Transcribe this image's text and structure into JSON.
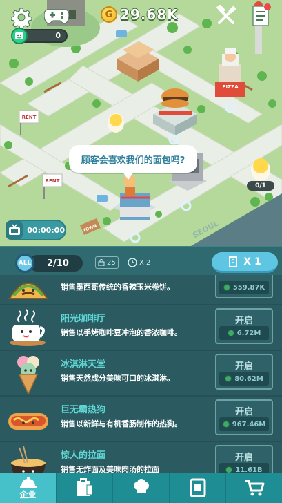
{
  "hud": {
    "coins": "29.68K",
    "coin_symbol": "G",
    "xp_value": "0",
    "speech": "顾客会喜欢我们的面包吗?",
    "timer": "00:00:00",
    "chick_counter": "0/1"
  },
  "map_signs": {
    "rent": "RENT",
    "pizza": "PIZZA",
    "town": "TOWN",
    "seoul": "SEOUL"
  },
  "panel": {
    "all_label": "ALL",
    "count": "2/10",
    "lock_value": "25",
    "speed_value": "X 2",
    "multiplier": "X 1"
  },
  "businesses": [
    {
      "title": "",
      "desc": "销售墨西哥传统的香辣玉米卷饼。",
      "button": "",
      "cost": "559.87K",
      "icon": "taco-icon"
    },
    {
      "title": "阳光咖啡厅",
      "desc": "销售以手烤咖啡豆冲泡的香浓咖啡。",
      "button": "开启",
      "cost": "6.72M",
      "icon": "coffee-cup-icon"
    },
    {
      "title": "冰淇淋天堂",
      "desc": "销售天然成分美味可口的冰淇淋。",
      "button": "开启",
      "cost": "80.62M",
      "icon": "ice-cream-icon"
    },
    {
      "title": "巨无霸热狗",
      "desc": "销售以新鲜与有机香肠制作的热狗。",
      "button": "开启",
      "cost": "967.46M",
      "icon": "hot-dog-icon"
    },
    {
      "title": "惊人的拉面",
      "desc": "销售无炸面及美味肉汤的拉面",
      "button": "开启",
      "cost": "11.61B",
      "icon": "ramen-icon"
    }
  ],
  "nav": [
    {
      "label": "企业",
      "icon": "building-icon",
      "active": true
    },
    {
      "label": "",
      "icon": "clipboard-icon",
      "active": false
    },
    {
      "label": "",
      "icon": "chef-hat-icon",
      "active": false
    },
    {
      "label": "",
      "icon": "menu-book-icon",
      "active": false
    },
    {
      "label": "",
      "icon": "cart-icon",
      "active": false
    }
  ],
  "colors": {
    "grass": "#b5d99b",
    "panel": "#2b5b61",
    "accent": "#5ec6e2",
    "nav": "#1e8d94"
  }
}
